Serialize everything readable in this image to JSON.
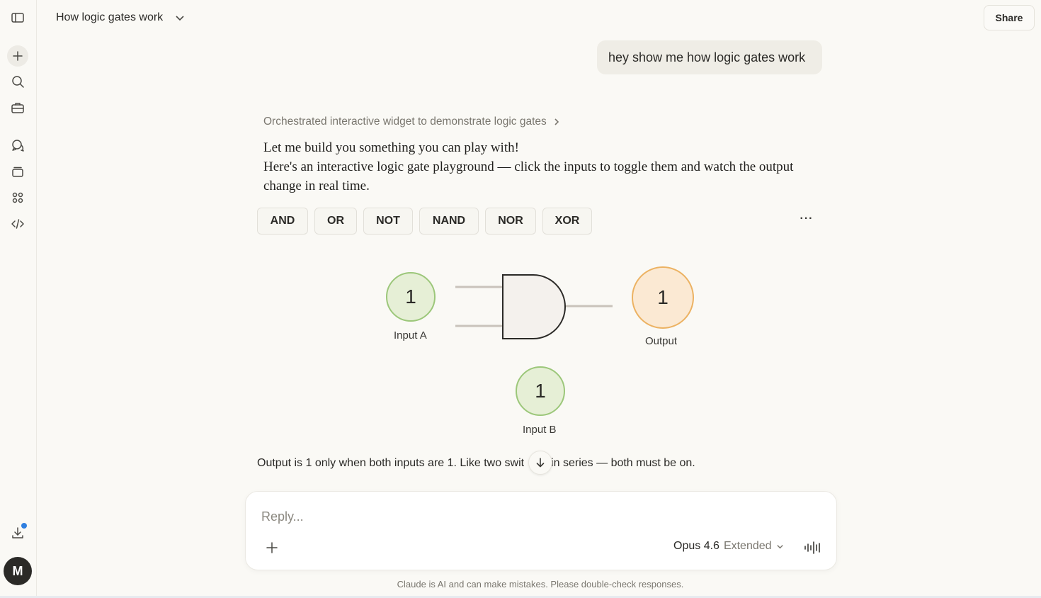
{
  "sidebar": {
    "items": [
      {
        "icon": "sidebar-toggle-icon"
      },
      {
        "icon": "plus-icon"
      },
      {
        "icon": "search-icon"
      },
      {
        "icon": "briefcase-icon"
      },
      {
        "icon": "chats-icon"
      },
      {
        "icon": "projects-icon"
      },
      {
        "icon": "artifacts-icon"
      },
      {
        "icon": "code-icon"
      },
      {
        "icon": "download-icon"
      }
    ],
    "avatar_initial": "M",
    "notification_color": "#2f7fe0"
  },
  "header": {
    "title": "How logic gates work",
    "share_label": "Share"
  },
  "conversation": {
    "user_message": "hey show me how logic gates work",
    "thought_summary": "Orchestrated interactive widget to demonstrate logic gates",
    "answer_line1": "Let me build you something you can play with!",
    "answer_line2": "Here's an interactive logic gate playground — click the inputs to toggle them and watch the output change in real time."
  },
  "widget": {
    "gate_tabs": [
      "AND",
      "OR",
      "NOT",
      "NAND",
      "NOR",
      "XOR"
    ],
    "selected_gate": "AND",
    "more_label": "···",
    "input_a": {
      "label": "Input A",
      "value": "1"
    },
    "input_b": {
      "label": "Input B",
      "value": "1"
    },
    "output": {
      "label": "Output",
      "value": "1"
    },
    "explanation_before": "Output is 1 only when both inputs are 1. Like two swit",
    "explanation_after": "in series — both must be on.",
    "colors": {
      "input_on": "#9cc77a",
      "output_on": "#ecb262"
    }
  },
  "composer": {
    "placeholder": "Reply...",
    "model_name": "Opus 4.6",
    "model_variant": "Extended",
    "disclaimer": "Claude is AI and can make mistakes. Please double-check responses."
  }
}
